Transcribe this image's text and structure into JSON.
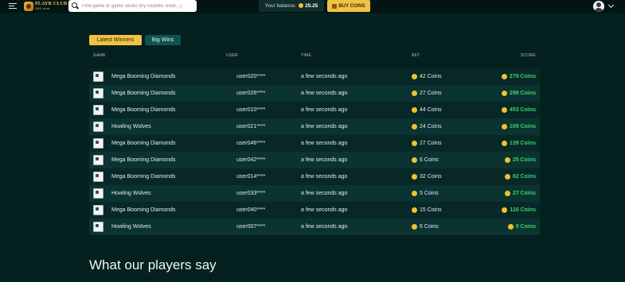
{
  "header": {
    "logo_line1": "PLAYR CLUB",
    "logo_line2": "365.com",
    "search_placeholder": "Find game or game studio (try roulette, book...)",
    "balance_label": "Your balance:",
    "balance_amount": "25.25",
    "buy_label": "BUY COINS"
  },
  "tabs": [
    {
      "label": "Latest Winners",
      "active": true
    },
    {
      "label": "Big Wins",
      "active": false
    }
  ],
  "table": {
    "columns": [
      "GAME",
      "USER",
      "TIME",
      "BET",
      "SCORE"
    ],
    "rows": [
      {
        "game": "Mega Booming Diamonds",
        "user": "user020****",
        "time": "a few seconds ago",
        "bet": "42 Coins",
        "score": "279 Coins"
      },
      {
        "game": "Mega Booming Diamonds",
        "user": "user026****",
        "time": "a few seconds ago",
        "bet": "27 Coins",
        "score": "296 Coins"
      },
      {
        "game": "Mega Booming Diamonds",
        "user": "user010****",
        "time": "a few seconds ago",
        "bet": "44 Coins",
        "score": "453 Coins"
      },
      {
        "game": "Howling Wolves",
        "user": "user021****",
        "time": "a few seconds ago",
        "bet": "24 Coins",
        "score": "109 Coins"
      },
      {
        "game": "Mega Booming Diamonds",
        "user": "user046****",
        "time": "a few seconds ago",
        "bet": "27 Coins",
        "score": "139 Coins"
      },
      {
        "game": "Mega Booming Diamonds",
        "user": "user042****",
        "time": "a few seconds ago",
        "bet": "6 Coins",
        "score": "25 Coins"
      },
      {
        "game": "Mega Booming Diamonds",
        "user": "user014****",
        "time": "a few seconds ago",
        "bet": "32 Coins",
        "score": "62 Coins"
      },
      {
        "game": "Howling Wolves",
        "user": "user033****",
        "time": "a few seconds ago",
        "bet": "5 Coins",
        "score": "27 Coins"
      },
      {
        "game": "Mega Booming Diamonds",
        "user": "user040****",
        "time": "a few seconds ago",
        "bet": "15 Coins",
        "score": "116 Coins"
      },
      {
        "game": "Howling Wolves",
        "user": "user007****",
        "time": "a few seconds ago",
        "bet": "6 Coins",
        "score": "9 Coins"
      }
    ]
  },
  "section_title": "What our players say",
  "colors": {
    "background": "#04201f",
    "accent": "#f0c244",
    "score_green": "#3ed16a",
    "tab_inactive": "#0f5351"
  }
}
